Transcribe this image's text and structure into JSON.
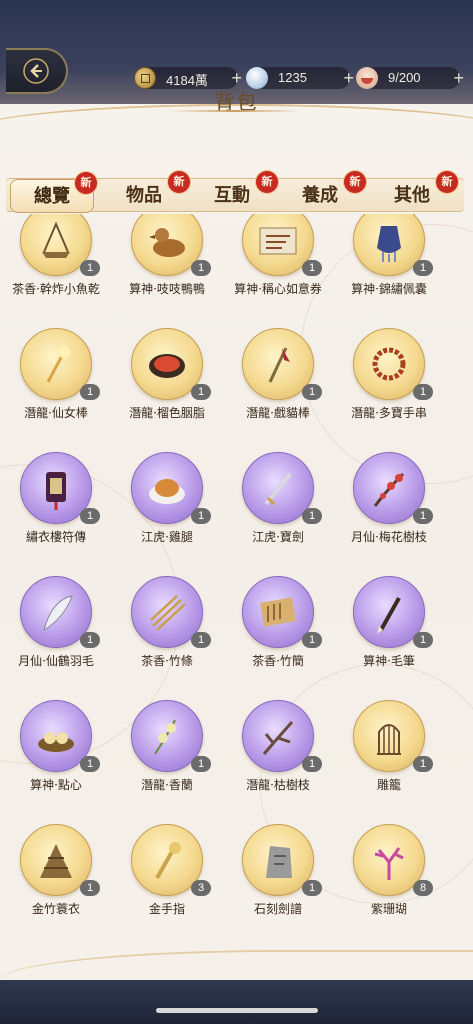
{
  "header": {
    "title": "背包",
    "back_icon": "back-arrow-icon",
    "resources": [
      {
        "name": "coin",
        "icon": "coin-icon",
        "value": "4184萬",
        "plus": "+"
      },
      {
        "name": "pearl",
        "icon": "pearl-icon",
        "value": "1235",
        "plus": "+"
      },
      {
        "name": "food",
        "icon": "bowl-icon",
        "value": "9/200",
        "plus": "+"
      }
    ]
  },
  "tabs": [
    {
      "label": "總覽",
      "badge": "新",
      "active": true
    },
    {
      "label": "物品",
      "badge": "新"
    },
    {
      "label": "互動",
      "badge": "新"
    },
    {
      "label": "養成",
      "badge": "新"
    },
    {
      "label": "其他",
      "badge": "新"
    }
  ],
  "items": [
    {
      "name": "茶香·幹炸小魚乾",
      "count": "1",
      "rarity": "gold",
      "icon": "basket-icon"
    },
    {
      "name": "算神·吱吱鴨鴨",
      "count": "1",
      "rarity": "gold",
      "icon": "wooden-duck-icon"
    },
    {
      "name": "算神·稱心如意券",
      "count": "1",
      "rarity": "gold",
      "icon": "coupon-icon"
    },
    {
      "name": "算神·錦繡佩囊",
      "count": "1",
      "rarity": "gold",
      "icon": "pouch-icon"
    },
    {
      "name": "潛龍·仙女棒",
      "count": "1",
      "rarity": "gold",
      "icon": "sparkler-icon"
    },
    {
      "name": "潛龍·榴色胭脂",
      "count": "1",
      "rarity": "gold",
      "icon": "rouge-box-icon"
    },
    {
      "name": "潛龍·戲貓棒",
      "count": "1",
      "rarity": "gold",
      "icon": "cat-teaser-icon"
    },
    {
      "name": "潛龍·多寶手串",
      "count": "1",
      "rarity": "gold",
      "icon": "bracelet-icon"
    },
    {
      "name": "繡衣樓符傳",
      "count": "1",
      "rarity": "purple",
      "icon": "token-icon"
    },
    {
      "name": "江虎·雞腿",
      "count": "1",
      "rarity": "purple",
      "icon": "drumstick-icon"
    },
    {
      "name": "江虎·寶劍",
      "count": "1",
      "rarity": "purple",
      "icon": "sword-icon"
    },
    {
      "name": "月仙·梅花樹枝",
      "count": "1",
      "rarity": "purple",
      "icon": "plum-branch-icon"
    },
    {
      "name": "月仙·仙鶴羽毛",
      "count": "1",
      "rarity": "purple",
      "icon": "feather-icon"
    },
    {
      "name": "茶香·竹條",
      "count": "1",
      "rarity": "purple",
      "icon": "bamboo-sticks-icon"
    },
    {
      "name": "茶香·竹簡",
      "count": "1",
      "rarity": "purple",
      "icon": "scroll-icon"
    },
    {
      "name": "算神·毛筆",
      "count": "1",
      "rarity": "purple",
      "icon": "brush-icon"
    },
    {
      "name": "算神·點心",
      "count": "1",
      "rarity": "purple",
      "icon": "dim-sum-icon"
    },
    {
      "name": "潛龍·香蘭",
      "count": "1",
      "rarity": "purple",
      "icon": "orchid-icon"
    },
    {
      "name": "潛龍·枯樹枝",
      "count": "1",
      "rarity": "purple",
      "icon": "dry-branch-icon"
    },
    {
      "name": "雕籠",
      "count": "1",
      "rarity": "gold",
      "icon": "cage-icon"
    },
    {
      "name": "金竹蓑衣",
      "count": "1",
      "rarity": "gold",
      "icon": "straw-cape-icon"
    },
    {
      "name": "金手指",
      "count": "3",
      "rarity": "gold",
      "icon": "golden-finger-icon"
    },
    {
      "name": "石刻劍譜",
      "count": "1",
      "rarity": "gold",
      "icon": "stone-tablet-icon"
    },
    {
      "name": "紫珊瑚",
      "count": "8",
      "rarity": "gold",
      "icon": "coral-icon"
    }
  ]
}
